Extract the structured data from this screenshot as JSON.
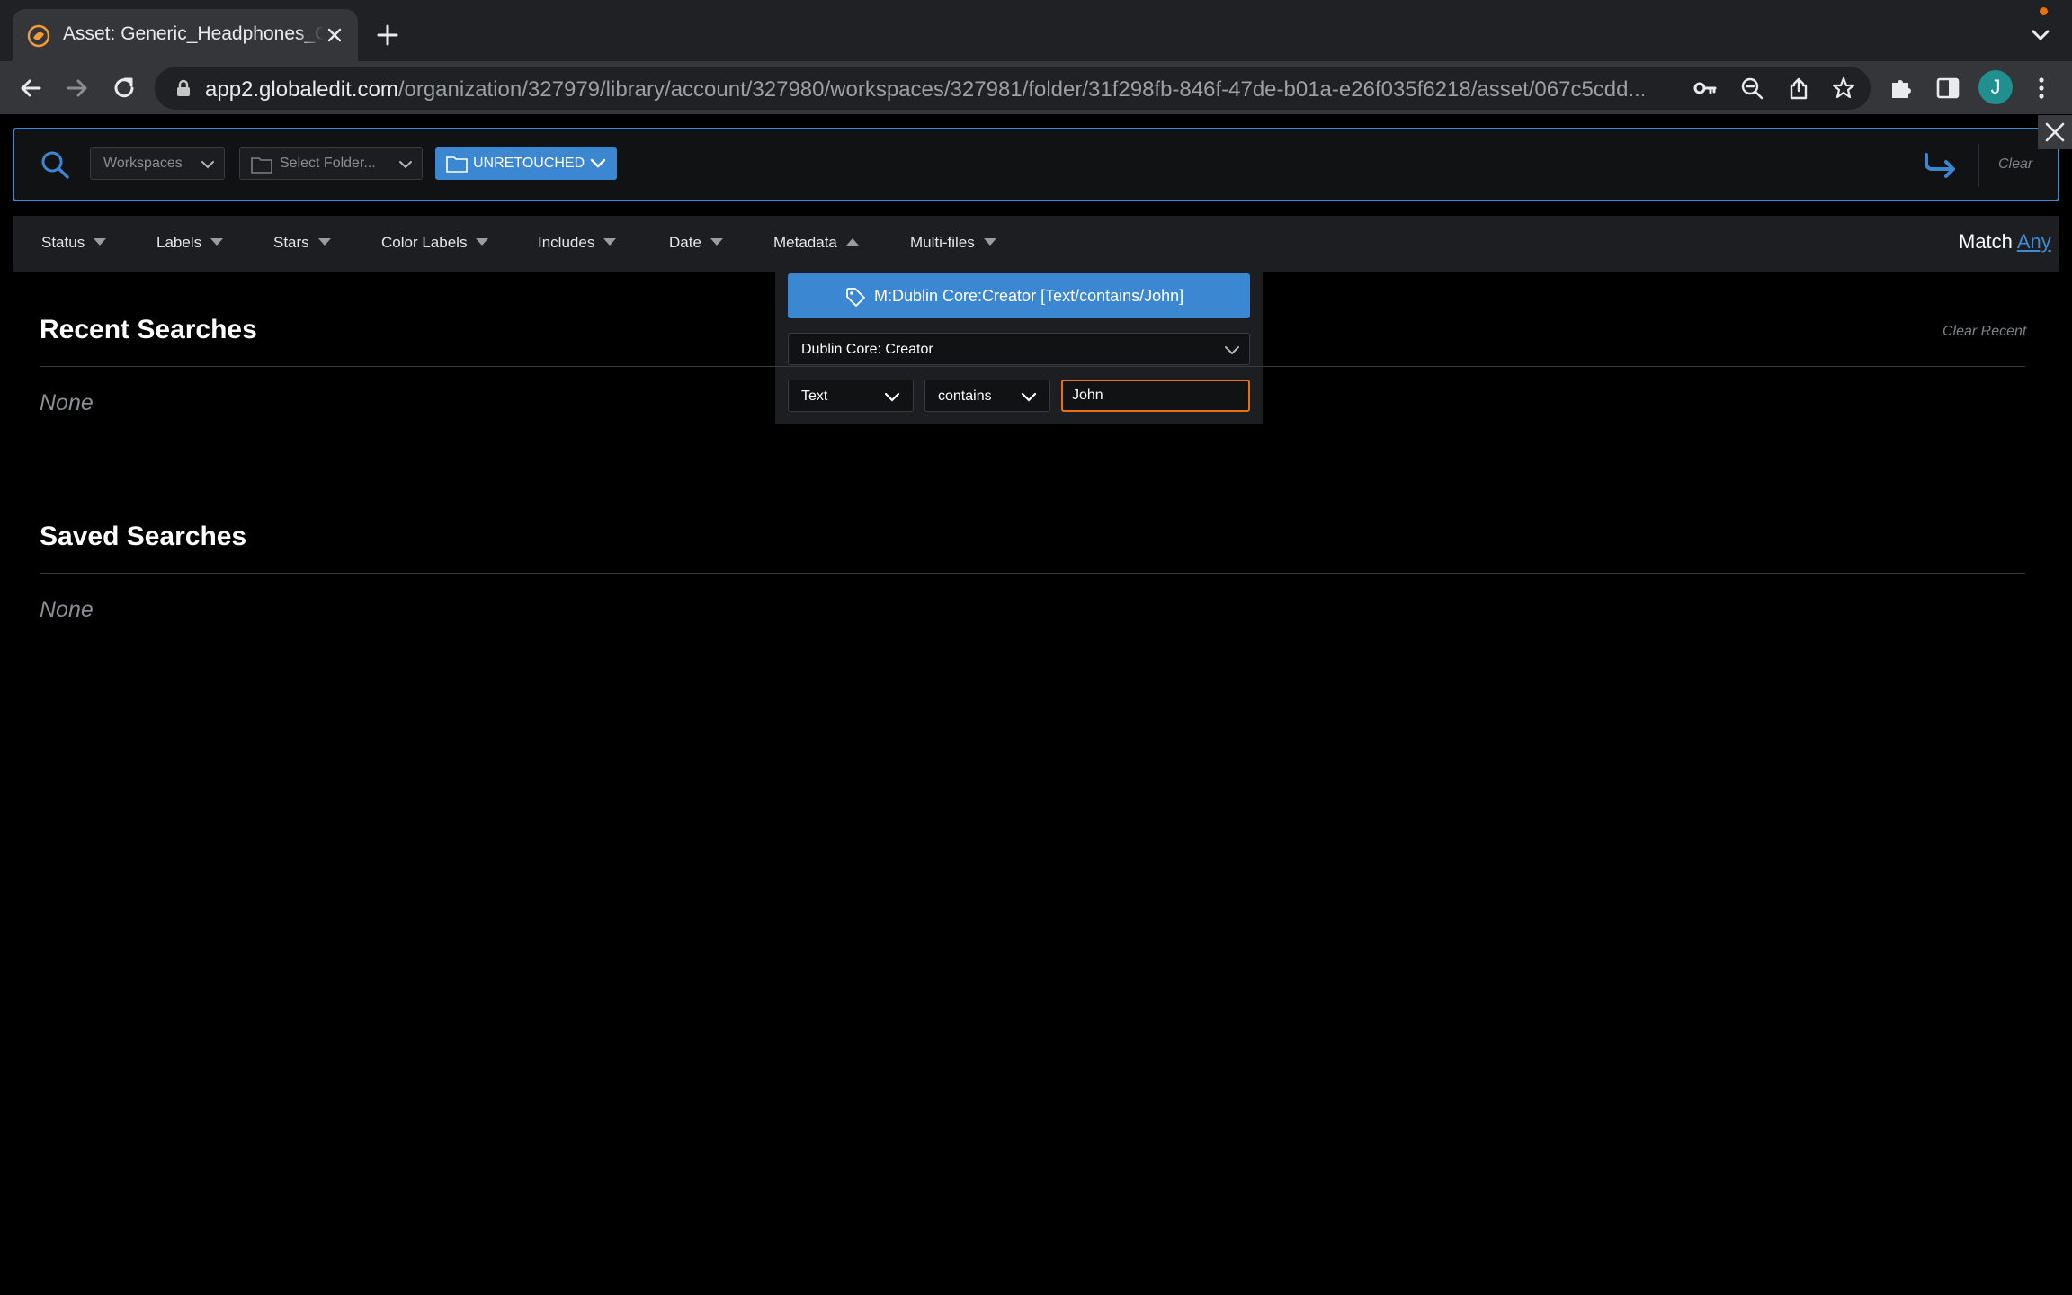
{
  "browser": {
    "tab_title": "Asset: Generic_Headphones_C",
    "url_host": "app2.globaledit.com",
    "url_path": "/organization/327979/library/account/327980/workspaces/327981/folder/31f298fb-846f-47de-b01a-e26f035f6218/asset/067c5cdd...",
    "profile_initial": "J"
  },
  "search_bar": {
    "workspaces_label": "Workspaces",
    "folder_placeholder": "Select Folder...",
    "folder_selected": "UNRETOUCHED",
    "clear_label": "Clear"
  },
  "filters": {
    "status": "Status",
    "labels": "Labels",
    "stars": "Stars",
    "color_labels": "Color Labels",
    "includes": "Includes",
    "date": "Date",
    "metadata": "Metadata",
    "multi_files": "Multi-files",
    "match_label": "Match",
    "match_value": "Any"
  },
  "metadata_panel": {
    "chip_text": "M:Dublin Core:Creator [Text/contains/John]",
    "field": "Dublin Core: Creator",
    "type": "Text",
    "operator": "contains",
    "value": "John"
  },
  "recent": {
    "title": "Recent Searches",
    "clear_label": "Clear Recent",
    "empty": "None"
  },
  "saved": {
    "title": "Saved Searches",
    "empty": "None"
  },
  "colors": {
    "accent": "#3b87d1",
    "focus": "#e8710a",
    "background": "#000000"
  }
}
